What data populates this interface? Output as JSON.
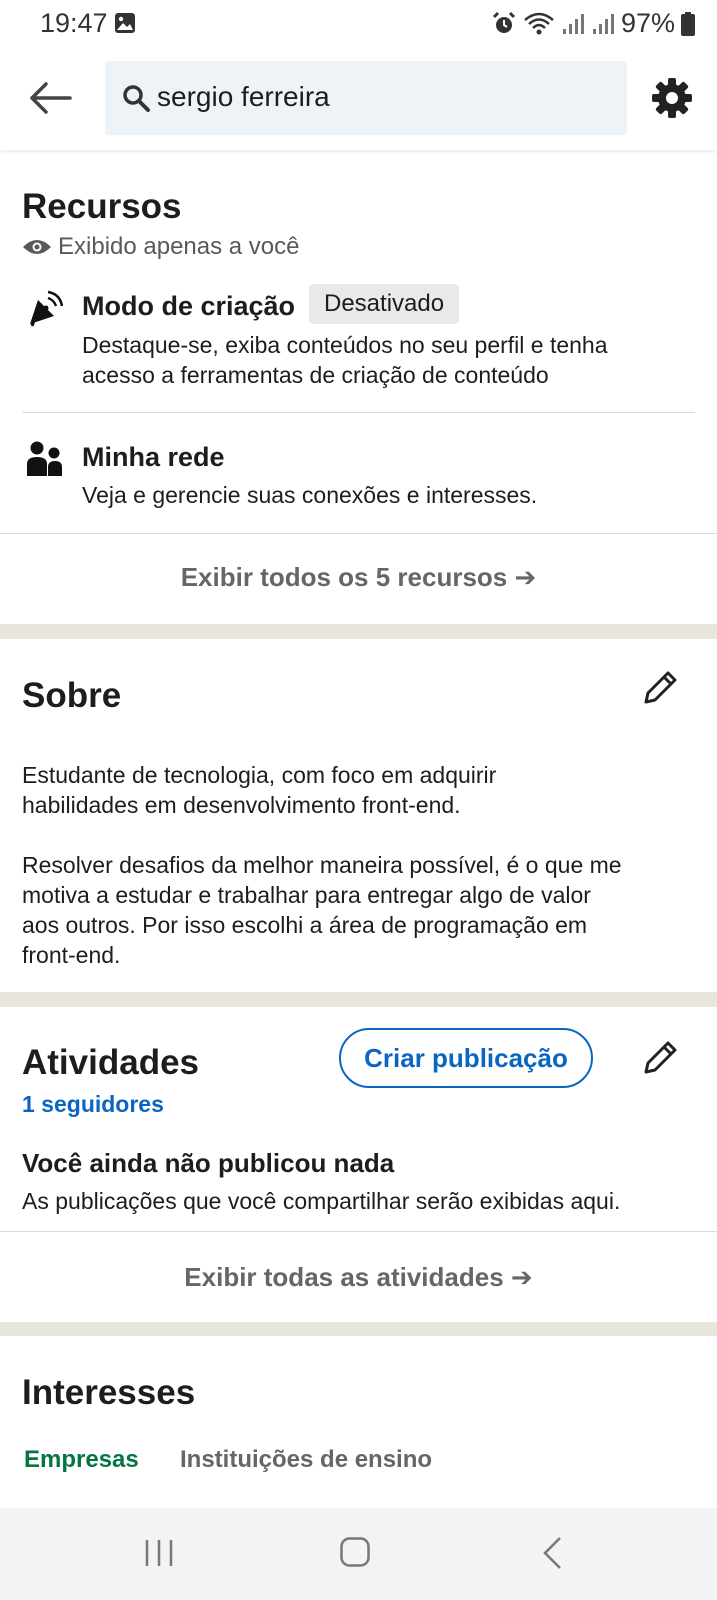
{
  "status_bar": {
    "time": "19:47",
    "battery": "97%"
  },
  "search": {
    "query": "sergio ferreira"
  },
  "resources": {
    "title": "Recursos",
    "visibility": "Exibido apenas a você",
    "items": [
      {
        "title": "Modo de criação",
        "badge": "Desativado",
        "description_line1": "Destaque-se, exiba conteúdos no seu perfil e tenha",
        "description_line2": "acesso a ferramentas de criação de conteúdo"
      },
      {
        "title": "Minha rede",
        "description_line1": "Veja e gerencie suas conexões e interesses."
      }
    ],
    "show_all": "Exibir todos os 5 recursos"
  },
  "about": {
    "title": "Sobre",
    "p1_line1": "Estudante de tecnologia, com foco em adquirir",
    "p1_line2": "habilidades em desenvolvimento front-end.",
    "p2_line1": "Resolver desafios da melhor maneira possível, é o que me",
    "p2_line2": "motiva a estudar e trabalhar para entregar algo de valor",
    "p2_line3": "aos outros. Por isso escolhi a área de programação em",
    "p2_line4": "front-end."
  },
  "activity": {
    "title": "Atividades",
    "followers": "1 seguidores",
    "create_post": "Criar publicação",
    "empty_title": "Você ainda não publicou nada",
    "empty_desc": "As publicações que você compartilhar serão exibidas aqui.",
    "show_all": "Exibir todas as atividades"
  },
  "interests": {
    "title": "Interesses",
    "tabs": [
      "Empresas",
      "Instituições de ensino"
    ]
  },
  "colors": {
    "accent": "#0a66c2",
    "active_tab": "#057642"
  }
}
